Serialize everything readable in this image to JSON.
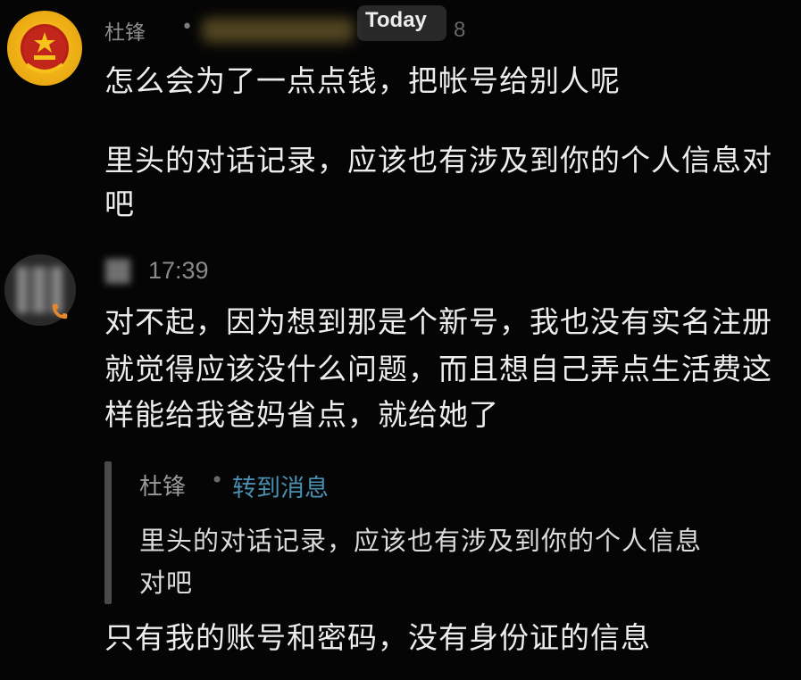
{
  "date_divider": "Today",
  "messages": [
    {
      "sender": "杜锋",
      "time_tail": "8",
      "avatar": "police-emblem-icon",
      "paragraphs": [
        "怎么会为了一点点钱，把帐号给别人呢",
        "里头的对话记录，应该也有涉及到你的个人信息对",
        "吧"
      ]
    },
    {
      "time": "17:39",
      "avatar": "blurred-avatar",
      "badge_icon": "phone-icon",
      "lines": [
        "对不起，因为想到那是个新号，我也没有实名注册",
        "就觉得应该没什么问题，而且想自己弄点生活费这",
        "样能给我爸妈省点，就给她了"
      ],
      "quote": {
        "sender": "杜锋",
        "link": "转到消息",
        "lines": [
          "里头的对话记录，应该也有涉及到你的个人信息",
          "对吧"
        ]
      },
      "reply": "只有我的账号和密码，没有身份证的信息"
    }
  ],
  "colors": {
    "background": "#050505",
    "text": "#ededed",
    "muted": "#8d8d8d",
    "link": "#4a8fb0",
    "quote_bar": "#4a4a4a"
  }
}
